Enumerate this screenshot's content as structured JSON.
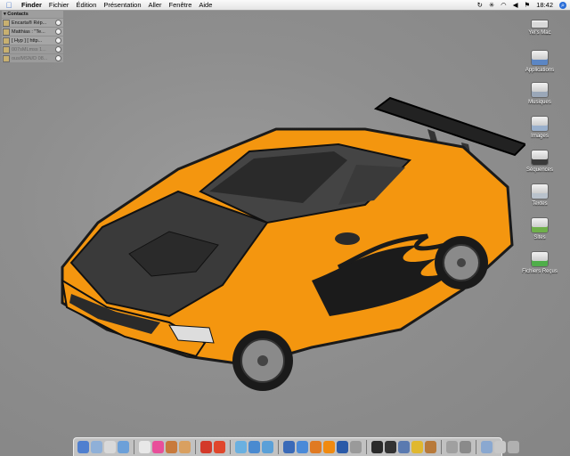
{
  "menubar": {
    "apple": "",
    "items": [
      "Finder",
      "Fichier",
      "Édition",
      "Présentation",
      "Aller",
      "Fenêtre",
      "Aide"
    ],
    "clock": "18:42"
  },
  "contacts": {
    "title": "Contacts",
    "rows": [
      {
        "name": "Encarta® Rép...",
        "dim": false
      },
      {
        "name": "Matthias : \"Te...",
        "dim": false
      },
      {
        "name": "[ Hyp ] [ http...",
        "dim": false
      },
      {
        "name": "007sMLmss 1...",
        "dim": true
      },
      {
        "name": "ous/MSN/D 08...",
        "dim": true
      }
    ]
  },
  "desktop_icons": [
    {
      "label": "Yel's Mac",
      "type": "hd",
      "color": "#d8d8d8"
    },
    {
      "label": "Applications",
      "type": "folder",
      "color": "#5b86c4"
    },
    {
      "label": "Musiques",
      "type": "folder",
      "color": "#9aa7b8"
    },
    {
      "label": "Images",
      "type": "folder",
      "color": "#9ab0cc"
    },
    {
      "label": "Séquences",
      "type": "folder",
      "color": "#3a3a3a"
    },
    {
      "label": "Textes",
      "type": "folder",
      "color": "#b9c2cc"
    },
    {
      "label": "Sites",
      "type": "folder",
      "color": "#6fb04a"
    },
    {
      "label": "Fichiers Reçus",
      "type": "folder",
      "color": "#4fae4a"
    }
  ],
  "dock": {
    "groups": [
      [
        "finder",
        "mail",
        "ical",
        "itunes"
      ],
      [
        "textedit",
        "flower",
        "photo",
        "ichat"
      ],
      [
        "spell",
        "red-app"
      ],
      [
        "bars",
        "bluebars",
        "waves"
      ],
      [
        "clock-app",
        "safari",
        "firefox",
        "vlc",
        "quicktime",
        "address"
      ],
      [
        "dashboard",
        "terminal",
        "preview",
        "network",
        "sherlock"
      ],
      [
        "tools",
        "sysprefs"
      ],
      [
        "folder-docs",
        "screen",
        "trash"
      ]
    ],
    "colors": {
      "finder": "#4f7fcf",
      "mail": "#8fb0d8",
      "ical": "#d9d9d9",
      "itunes": "#6ca0d9",
      "textedit": "#e8e8e8",
      "flower": "#e84f9a",
      "photo": "#c87a3c",
      "ichat": "#d9a060",
      "spell": "#d33a2a",
      "red-app": "#e0472c",
      "bars": "#6ab0e0",
      "bluebars": "#4a8ad0",
      "waves": "#5aa0d8",
      "clock-app": "#3a6ab8",
      "safari": "#4a8ad8",
      "firefox": "#e07a22",
      "vlc": "#f08a10",
      "quicktime": "#2a5aa8",
      "address": "#9a9a9a",
      "dashboard": "#2a2a2a",
      "terminal": "#333333",
      "preview": "#5a7ab0",
      "network": "#e0b830",
      "sherlock": "#b87a3a",
      "tools": "#a0a0a0",
      "sysprefs": "#8a8a8a",
      "folder-docs": "#8aa8d0",
      "screen": "#c8c8c8",
      "trash": "#b0b0b0"
    }
  },
  "wallpaper": {
    "car_color": "#f4960f",
    "flames_color": "#1b1b1b",
    "carbon_color": "#333333"
  }
}
